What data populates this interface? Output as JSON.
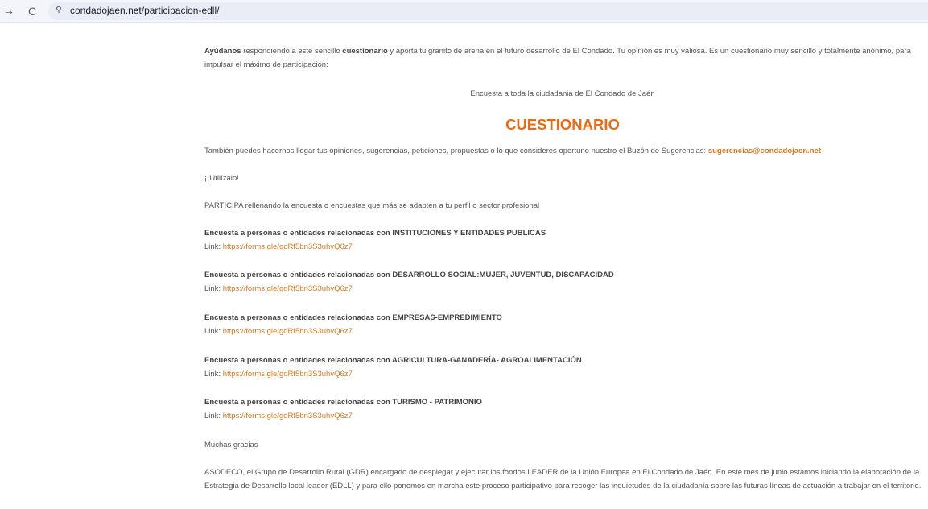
{
  "browser": {
    "url": "condadojaen.net/participacion-edll/",
    "forward_glyph": "→",
    "reload_glyph": "C",
    "site_info_glyph": "⚲"
  },
  "intro": {
    "strong1": "Ayúdanos",
    "text1": " respondiendo a este sencillo ",
    "strong2": "cuestionario",
    "text2": " y aporta tu granito de arena en el futuro desarrollo de El Condado. Tu opinión es muy valiosa. Es un cuestionario muy sencillo y totalmente anónimo, para impulsar el máximo de participación:"
  },
  "survey_heading": "Encuesta a toda la ciudadania de El Condado de Jaén",
  "title": "CUESTIONARIO",
  "suggestions": {
    "text": "También puedes hacernos llegar tus opiniones, sugerencias, peticiones, propuestas o lo que consideres oportuno nuestro el Buzón de Sugerencias: ",
    "email": "sugerencias@condadojaen.net"
  },
  "utilizalo": "¡¡Utilízalo!",
  "participa": "PARTICIPA rellenando la encuesta o encuestas que más se adapten a tu perfil o sector profesional",
  "link_label": "Link: ",
  "surveys": [
    {
      "title": "Encuesta a personas o entidades relacionadas con INSTITUCIONES Y ENTIDADES PUBLICAS",
      "link": "https://forms.gle/gdRf5bn3S3uhvQ6z7"
    },
    {
      "title": "Encuesta a personas o entidades relacionadas con DESARROLLO SOCIAL:MUJER, JUVENTUD, DISCAPACIDAD",
      "link": "https://forms.gle/gdRf5bn3S3uhvQ6z7"
    },
    {
      "title": "Encuesta a personas o entidades relacionadas con EMPRESAS-EMPREDIMIENTO",
      "link": "https://forms.gle/gdRf5bn3S3uhvQ6z7"
    },
    {
      "title": "Encuesta a personas o entidades relacionadas con AGRICULTURA-GANADERÍA- AGROALIMENTACIÓN",
      "link": "https://forms.gle/gdRf5bn3S3uhvQ6z7"
    },
    {
      "title": "Encuesta a personas o entidades relacionadas con TURISMO  - PATRIMONIO",
      "link": "https://forms.gle/gdRf5bn3S3uhvQ6z7"
    }
  ],
  "gracias": "Muchas gracias",
  "asodeco": "ASODECO, el Grupo de Desarrollo Rural (GDR) encargado de desplegar y ejecutar los fondos LEADER de la Unión Europea en El Condado de Jaén. En este mes de junio estamos iniciando la elaboración de la Estrategia de Desarrollo local leader (EDLL) y para ello ponemos en marcha este proceso participativo para recoger las inquietudes de la ciudadanía sobre las futuras líneas de actuación a trabajar en el territorio."
}
